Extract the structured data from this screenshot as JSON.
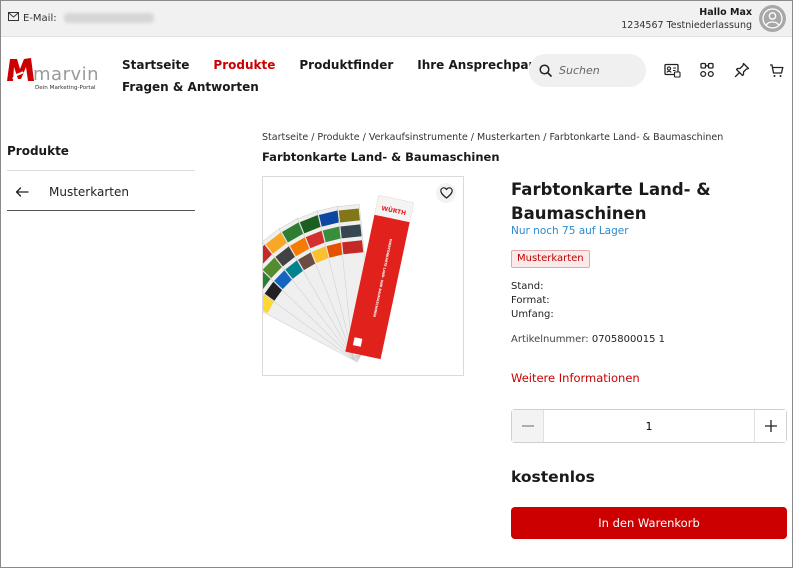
{
  "topbar": {
    "email_label": "E-Mail:",
    "greeting": "Hallo Max",
    "branch": "1234567 Testniederlassung"
  },
  "brand": {
    "name": "marvin",
    "tagline": "Dein Marketing-Portal",
    "accent_color": "#cc0000"
  },
  "nav": {
    "items": [
      {
        "label": "Startseite"
      },
      {
        "label": "Produkte"
      },
      {
        "label": "Produktfinder"
      },
      {
        "label": "Ihre Ansprechpartner"
      },
      {
        "label": "Fragen & Antworten"
      }
    ],
    "active": "Produkte"
  },
  "search": {
    "placeholder": "Suchen"
  },
  "header_icons": [
    "id-card-icon",
    "nodes-icon",
    "pin-icon",
    "cart-icon"
  ],
  "sidebar": {
    "title": "Produkte",
    "back_item": "Musterkarten"
  },
  "breadcrumb": {
    "items": [
      "Startseite",
      "Produkte",
      "Verkaufsinstrumente",
      "Musterkarten",
      "Farbtonkarte Land- & Baumaschinen"
    ],
    "separator": "/"
  },
  "page_title": "Farbtonkarte Land- & Baumaschinen",
  "product": {
    "title": "Farbtonkarte Land- & Baumaschinen",
    "stock": "Nur noch 75 auf Lager",
    "category_badge": "Musterkarten",
    "specs": {
      "stand_label": "Stand:",
      "format_label": "Format:",
      "umfang_label": "Umfang:"
    },
    "article_label": "Artikelnummer:",
    "article_number": "0705800015 1",
    "more_info": "Weitere Informationen",
    "quantity": "1",
    "price": "kostenlos",
    "add_to_cart": "In den Warenkorb",
    "card_text_brand": "WÜRTH",
    "card_text_title": "FARBTONKARTE LAND- UND BAUMASCHINEN",
    "stock_color": "#2a8bd1"
  }
}
